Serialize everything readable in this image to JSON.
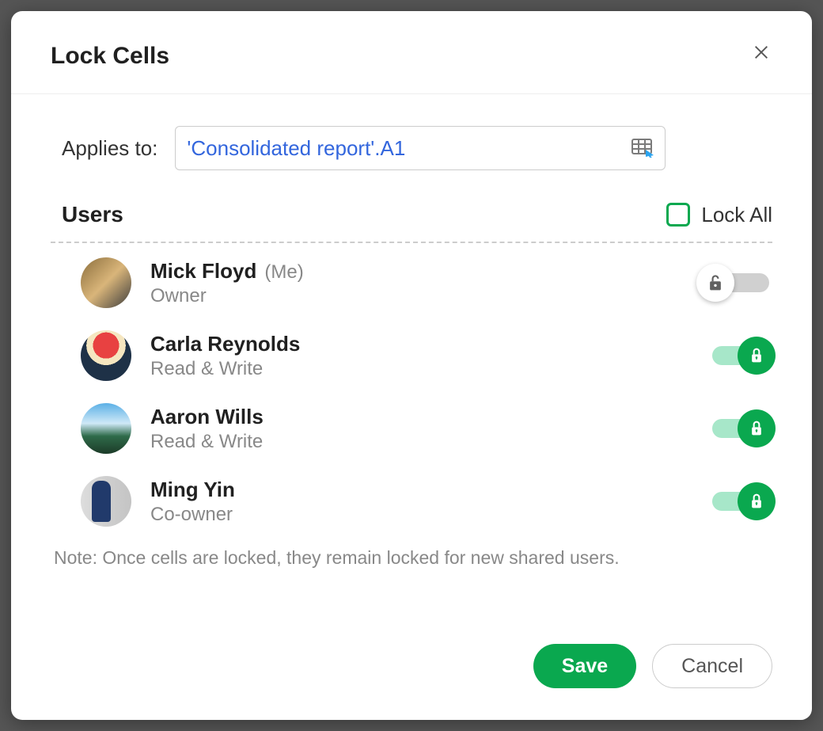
{
  "dialog": {
    "title": "Lock Cells"
  },
  "applies": {
    "label": "Applies to:",
    "value": "'Consolidated report'.A1"
  },
  "usersSection": {
    "heading": "Users",
    "lockAllLabel": "Lock All",
    "lockAllChecked": false
  },
  "users": [
    {
      "name": "Mick Floyd",
      "meSuffix": "(Me)",
      "role": "Owner",
      "locked": false
    },
    {
      "name": "Carla Reynolds",
      "meSuffix": "",
      "role": "Read & Write",
      "locked": true
    },
    {
      "name": "Aaron Wills",
      "meSuffix": "",
      "role": "Read & Write",
      "locked": true
    },
    {
      "name": "Ming Yin",
      "meSuffix": "",
      "role": "Co-owner",
      "locked": true
    }
  ],
  "note": "Note:  Once cells are locked, they remain locked for new shared users.",
  "buttons": {
    "save": "Save",
    "cancel": "Cancel"
  }
}
